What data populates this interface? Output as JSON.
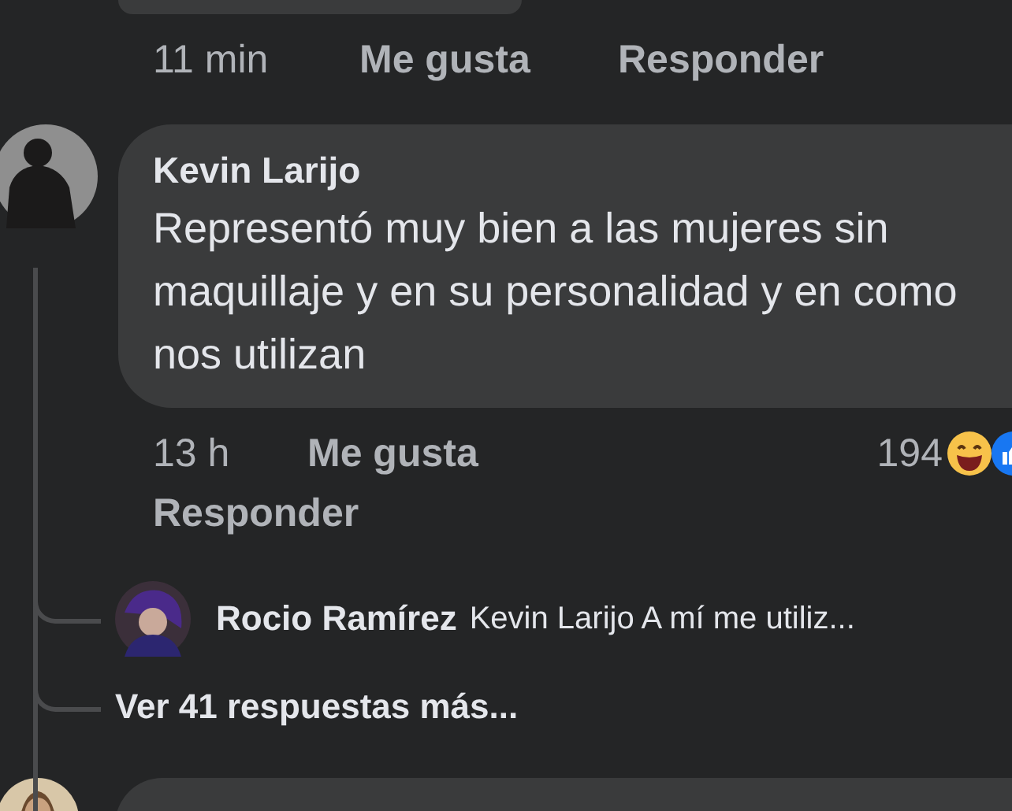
{
  "previous_comment": {
    "time": "11 min",
    "like": "Me gusta",
    "reply": "Responder"
  },
  "comment": {
    "author": "Kevin Larijo",
    "text": "Representó muy bien a las mujeres sin maquillaje y en su personalidad y en como nos utilizan",
    "time": "13 h",
    "like": "Me gusta",
    "reaction_count": "194",
    "reply": "Responder"
  },
  "replies": [
    {
      "author": "Rocio Ramírez",
      "text": "Kevin Larijo A mí me utiliz..."
    }
  ],
  "more_replies": "Ver 41 respuestas más..."
}
